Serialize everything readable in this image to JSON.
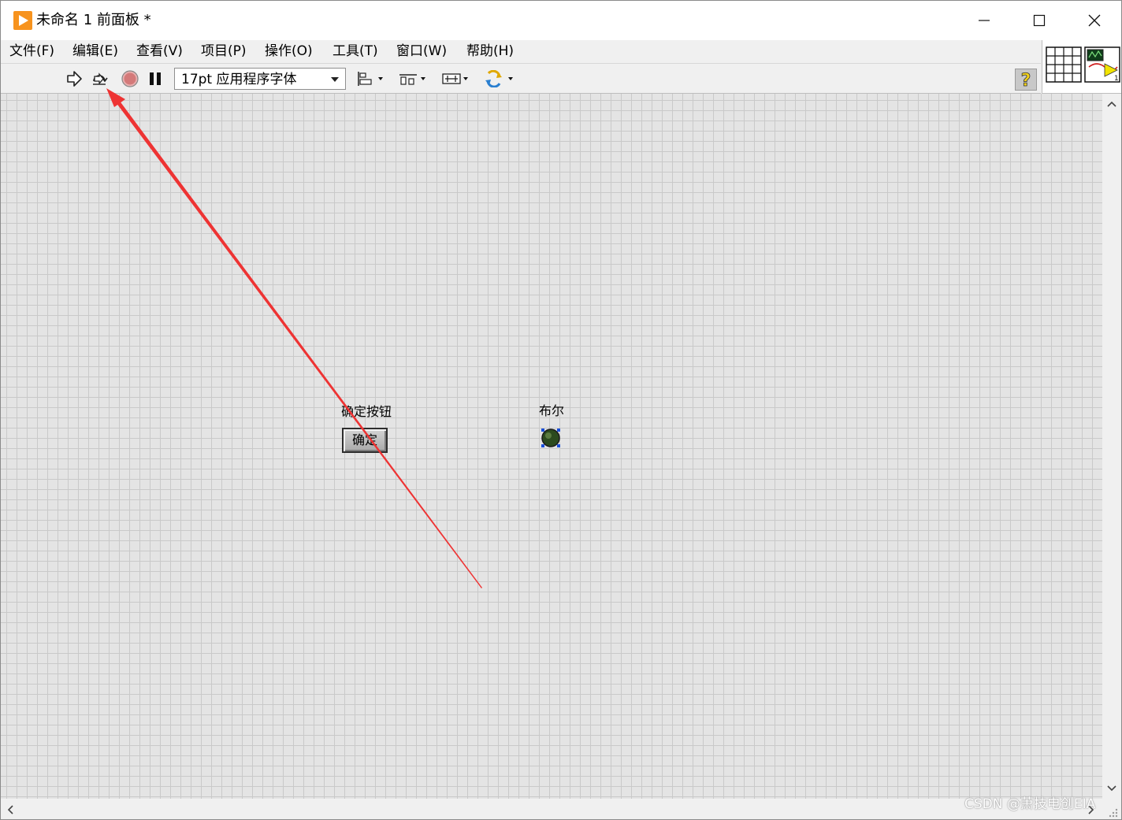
{
  "window": {
    "title": "未命名 1 前面板 *"
  },
  "menu": {
    "items": [
      "文件(F)",
      "编辑(E)",
      "查看(V)",
      "项目(P)",
      "操作(O)",
      "工具(T)",
      "窗口(W)",
      "帮助(H)"
    ]
  },
  "toolbar": {
    "font_selection": "17pt 应用程序字体"
  },
  "front_panel": {
    "ok_button": {
      "label": "确定按钮",
      "text": "确定"
    },
    "led": {
      "label": "布尔"
    }
  },
  "colors": {
    "canvas": "#e4e4e4",
    "grid": "#c9c9c9",
    "annotation_arrow": "#ee3333",
    "app_icon": "#f7931e"
  },
  "watermark": "CSDN @萧技电创EIA"
}
